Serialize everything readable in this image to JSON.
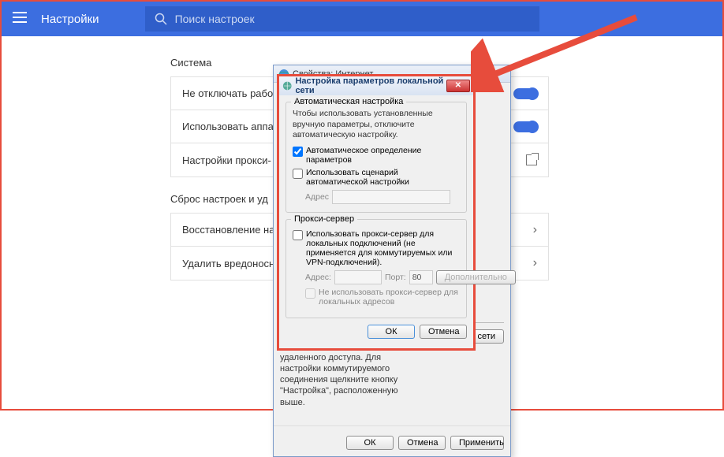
{
  "topbar": {
    "title": "Настройки",
    "search_placeholder": "Поиск настроек"
  },
  "sections": {
    "system": {
      "title": "Система",
      "rows": [
        "Не отключать рабо",
        "Использовать аппа",
        "Настройки прокси-"
      ]
    },
    "reset": {
      "title": "Сброс настроек и уд",
      "rows": [
        "Восстановление на",
        "Удалить вредоносн"
      ]
    }
  },
  "parent_dialog": {
    "title": "Свойства: Интернет",
    "lan_fieldset": "Настройка параметров локальной сети",
    "lan_text": "Параметры локальной сети не применяются для подключений удаленного доступа. Для настройки коммутируемого соединения щелкните кнопку \"Настройка\", расположенную выше.",
    "lan_button": "Настройка сети",
    "ok": "ОК",
    "cancel": "Отмена",
    "apply": "Применить"
  },
  "lan_dialog": {
    "title": "Настройка параметров локальной сети",
    "auto": {
      "legend": "Автоматическая настройка",
      "text": "Чтобы использовать установленные вручную параметры, отключите автоматическую настройку.",
      "cb1": "Автоматическое определение параметров",
      "cb2": "Использовать сценарий автоматической настройки",
      "addr_label": "Адрес"
    },
    "proxy": {
      "legend": "Прокси-сервер",
      "cb1": "Использовать прокси-сервер для локальных подключений (не применяется для коммутируемых или VPN-подключений).",
      "addr_label": "Адрес:",
      "port_label": "Порт:",
      "port_value": "80",
      "advanced": "Дополнительно",
      "cb2": "Не использовать прокси-сервер для локальных адресов"
    },
    "ok": "ОК",
    "cancel": "Отмена"
  }
}
